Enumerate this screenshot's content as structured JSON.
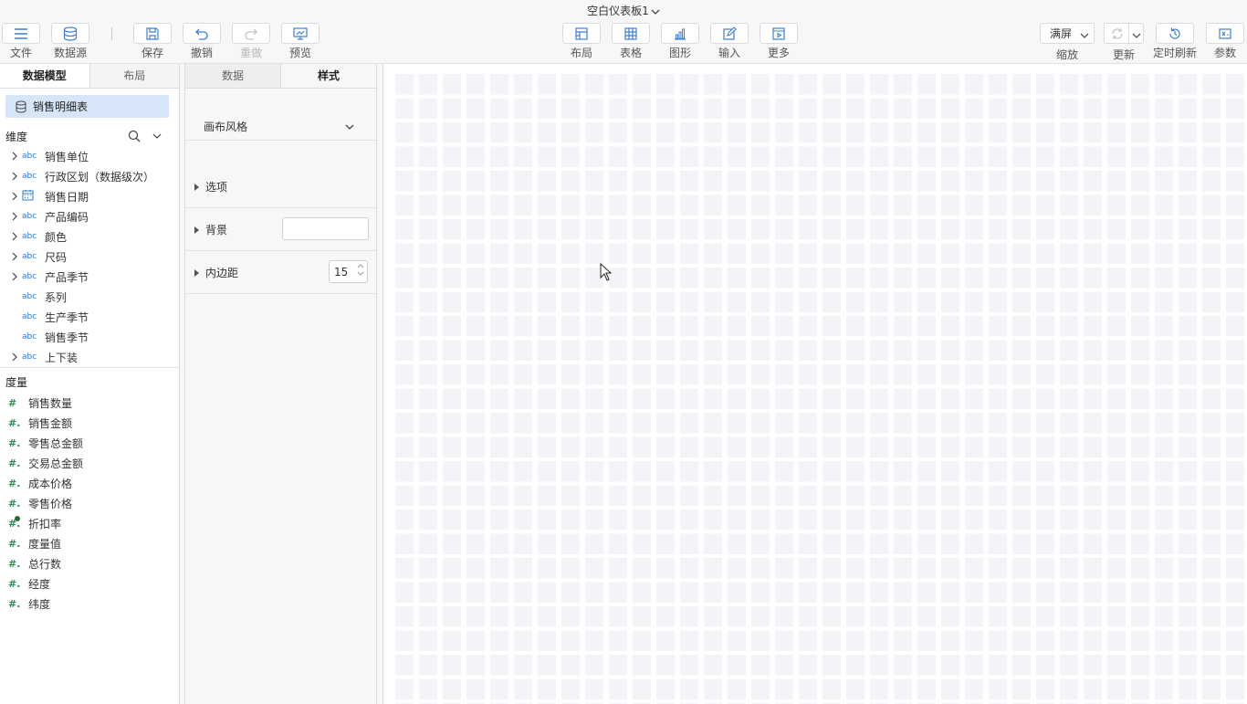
{
  "title": "空白仪表板1",
  "toolbar": {
    "file": "文件",
    "datasource": "数据源",
    "save": "保存",
    "undo": "撤销",
    "redo": "重做",
    "preview": "预览",
    "layout": "布局",
    "table": "表格",
    "chart": "图形",
    "input": "输入",
    "more": "更多",
    "zoom_value": "满屏",
    "zoom_label": "缩放",
    "refresh": "更新",
    "scheduled_refresh": "定时刷新",
    "params": "参数"
  },
  "model_panel": {
    "tabs": [
      "数据模型",
      "布局"
    ],
    "dataset": "销售明细表",
    "dimensions_title": "维度",
    "dimensions": [
      {
        "type": "abc",
        "name": "销售单位",
        "expandable": true
      },
      {
        "type": "abc",
        "name": "行政区划（数据级次）",
        "expandable": true
      },
      {
        "type": "date",
        "name": "销售日期",
        "expandable": true
      },
      {
        "type": "abc",
        "name": "产品编码",
        "expandable": true
      },
      {
        "type": "abc",
        "name": "颜色",
        "expandable": true
      },
      {
        "type": "abc",
        "name": "尺码",
        "expandable": true
      },
      {
        "type": "abc",
        "name": "产品季节",
        "expandable": true
      },
      {
        "type": "abc",
        "name": "系列",
        "expandable": false
      },
      {
        "type": "abc",
        "name": "生产季节",
        "expandable": false
      },
      {
        "type": "abc",
        "name": "销售季节",
        "expandable": false
      },
      {
        "type": "abc",
        "name": "上下装",
        "expandable": true
      }
    ],
    "measures_title": "度量",
    "measures": [
      {
        "name": "销售数量",
        "type": "#"
      },
      {
        "name": "销售金额",
        "type": "#."
      },
      {
        "name": "零售总金额",
        "type": "#."
      },
      {
        "name": "交易总金额",
        "type": "#."
      },
      {
        "name": "成本价格",
        "type": "#."
      },
      {
        "name": "零售价格",
        "type": "#."
      },
      {
        "name": "折扣率",
        "type": "#.",
        "marked": true
      },
      {
        "name": "度量值",
        "type": "#."
      },
      {
        "name": "总行数",
        "type": "#."
      },
      {
        "name": "经度",
        "type": "#."
      },
      {
        "name": "纬度",
        "type": "#."
      }
    ]
  },
  "prop_panel": {
    "tabs": [
      "数据",
      "样式"
    ],
    "canvas_style": "画布风格",
    "options": "选项",
    "background": "背景",
    "padding": "内边距",
    "padding_value": "15"
  },
  "colors": {
    "accent": "#2f7bd6",
    "dataset_bg": "#d6e6f8",
    "measure_icon": "#2e8b57"
  }
}
